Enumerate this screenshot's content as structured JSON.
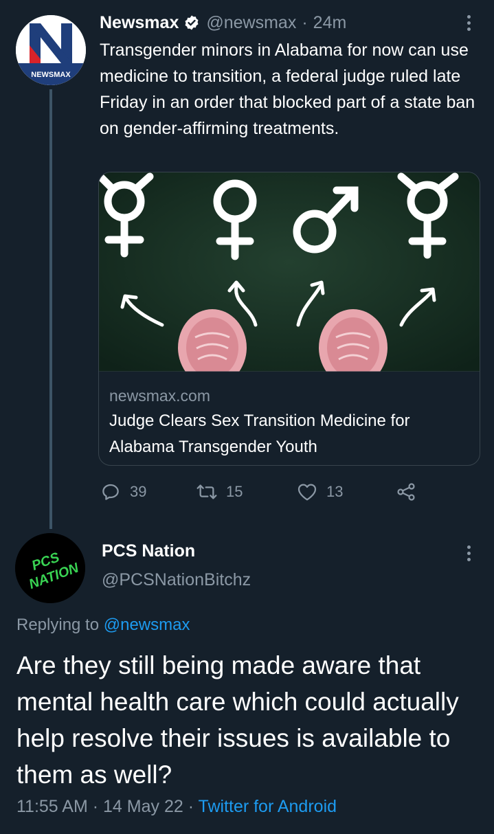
{
  "tweet": {
    "author_name": "Newsmax",
    "author_handle": "@newsmax",
    "separator": "·",
    "time_ago": "24m",
    "avatar_text": "NEWSMAX",
    "text": "Transgender minors in Alabama for now can use medicine to transition, a federal judge ruled late Friday in an order that blocked part of a state ban on gender-affirming treatments.",
    "card": {
      "domain": "newsmax.com",
      "title": "Judge Clears Sex Transition Medicine for Alabama Transgender Youth"
    },
    "actions": {
      "replies": "39",
      "retweets": "15",
      "likes": "13"
    }
  },
  "reply": {
    "author_name": "PCS Nation",
    "author_handle": "@PCSNationBitchz",
    "avatar_text_top": "PCS",
    "avatar_text_bottom": "NATION",
    "replying_prefix": "Replying to",
    "replying_to": "@newsmax",
    "text": "Are they still being made aware that mental health care which could actually help resolve their issues is available to them as well?",
    "time": "11:55 AM",
    "date": "14 May 22",
    "source": "Twitter for Android"
  },
  "colors": {
    "background": "#15202b",
    "accent": "#1d9bf0",
    "muted_text": "#8b98a5",
    "border": "#38444d",
    "newsmax_red": "#d8232a",
    "newsmax_blue": "#1f3e7b",
    "pcs_green": "#39d353"
  },
  "icons": [
    "verified-badge-icon",
    "more-icon",
    "reply-icon",
    "retweet-icon",
    "like-icon",
    "share-icon"
  ]
}
